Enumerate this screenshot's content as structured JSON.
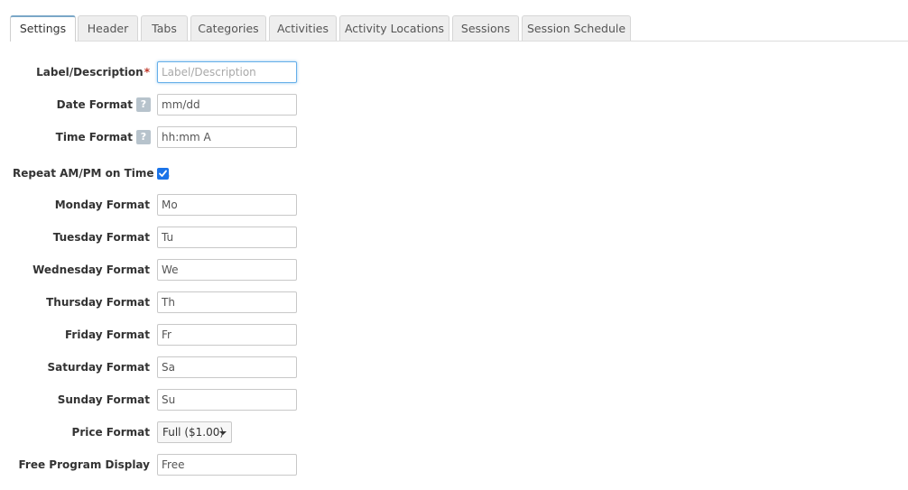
{
  "tabs": [
    {
      "label": "Settings",
      "active": true
    },
    {
      "label": "Header",
      "active": false
    },
    {
      "label": "Tabs",
      "active": false
    },
    {
      "label": "Categories",
      "active": false
    },
    {
      "label": "Activities",
      "active": false
    },
    {
      "label": "Activity Locations",
      "active": false
    },
    {
      "label": "Sessions",
      "active": false
    },
    {
      "label": "Session Schedule",
      "active": false
    }
  ],
  "form": {
    "label_description": {
      "label": "Label/Description",
      "required_mark": "*",
      "value": "",
      "placeholder": "Label/Description"
    },
    "date_format": {
      "label": "Date Format",
      "help": "?",
      "value": "mm/dd"
    },
    "time_format": {
      "label": "Time Format",
      "help": "?",
      "value": "hh:mm A"
    },
    "repeat_ampm": {
      "label": "Repeat AM/PM on Time ...",
      "checked": true
    },
    "monday_format": {
      "label": "Monday Format",
      "value": "Mo"
    },
    "tuesday_format": {
      "label": "Tuesday Format",
      "value": "Tu"
    },
    "wednesday_format": {
      "label": "Wednesday Format",
      "value": "We"
    },
    "thursday_format": {
      "label": "Thursday Format",
      "value": "Th"
    },
    "friday_format": {
      "label": "Friday Format",
      "value": "Fr"
    },
    "saturday_format": {
      "label": "Saturday Format",
      "value": "Sa"
    },
    "sunday_format": {
      "label": "Sunday Format",
      "value": "Su"
    },
    "price_format": {
      "label": "Price Format",
      "selected": "Full ($1.00)"
    },
    "free_program_display": {
      "label": "Free Program Display",
      "value": "Free"
    }
  },
  "colors": {
    "accent": "#1a73e8",
    "required": "#c0392b",
    "help_badge": "#b7c3cc",
    "focus_border": "#66afe9"
  }
}
